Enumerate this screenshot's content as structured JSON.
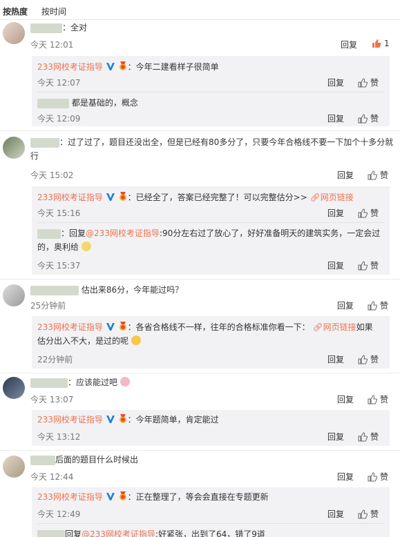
{
  "tabs": {
    "hot": "按热度",
    "time": "按时间"
  },
  "reply_label": "回复",
  "like_label": "赞",
  "author": "233网校考证指导",
  "web_link": "网页链接",
  "mention_author": "@233网校考证指导",
  "comments": [
    {
      "text": "：全对",
      "time": "今天 12:01",
      "likes": "1",
      "replies": [
        {
          "text": "：今年二建看样子很简单",
          "time": "今天 12:07"
        },
        {
          "text": "都是基础的，概念",
          "time": "今天 12:09"
        }
      ]
    },
    {
      "text_l1": "：过了过了，题目还没出全，但是已经有80多分了，只要今年合格线不要一下加个十多分就",
      "text_l2": "行",
      "time": "今天 15:02",
      "replies": [
        {
          "text": "：已经全了，答案已经完整了！可以完整估分>>",
          "time": "今天 15:16"
        },
        {
          "prefix": "：回复",
          "text_l1": ":90分左右过了放心了，好好准备明天的建筑实务，一定会过",
          "text_l2": "的，奥利给",
          "time": "今天 15:37"
        }
      ]
    },
    {
      "text": "估出来86分，今年能过吗？",
      "time": "25分钟前",
      "replies": [
        {
          "text_l1": "：各省合格线不一样，往年的合格标准你看一下：",
          "text_after": "如果",
          "text_l2": "估分出入不大，是过的呢",
          "time": "22分钟前"
        }
      ]
    },
    {
      "text": "：应该能过吧",
      "time": "今天 13:07",
      "replies": [
        {
          "text": "：今年题简单，肯定能过",
          "time": "今天 13:12"
        }
      ]
    },
    {
      "text": "后面的题目什么时候出",
      "time": "今天 12:44",
      "replies": [
        {
          "text": "：正在整理了，等会会直接在专题更新",
          "time": "今天 12:49"
        },
        {
          "prefix": "回复",
          "text": ":好紧张，出到了64，错了9道"
        }
      ]
    }
  ],
  "colors": {
    "author": "#eb7350",
    "vbadge": "#1a7fd9",
    "like_active": "#eb7350",
    "sub_bg": "#f2f2f5"
  },
  "icons": [
    "thumbs-up-icon",
    "vip-v-icon",
    "medal-icon",
    "link-icon",
    "emoji-icon"
  ]
}
